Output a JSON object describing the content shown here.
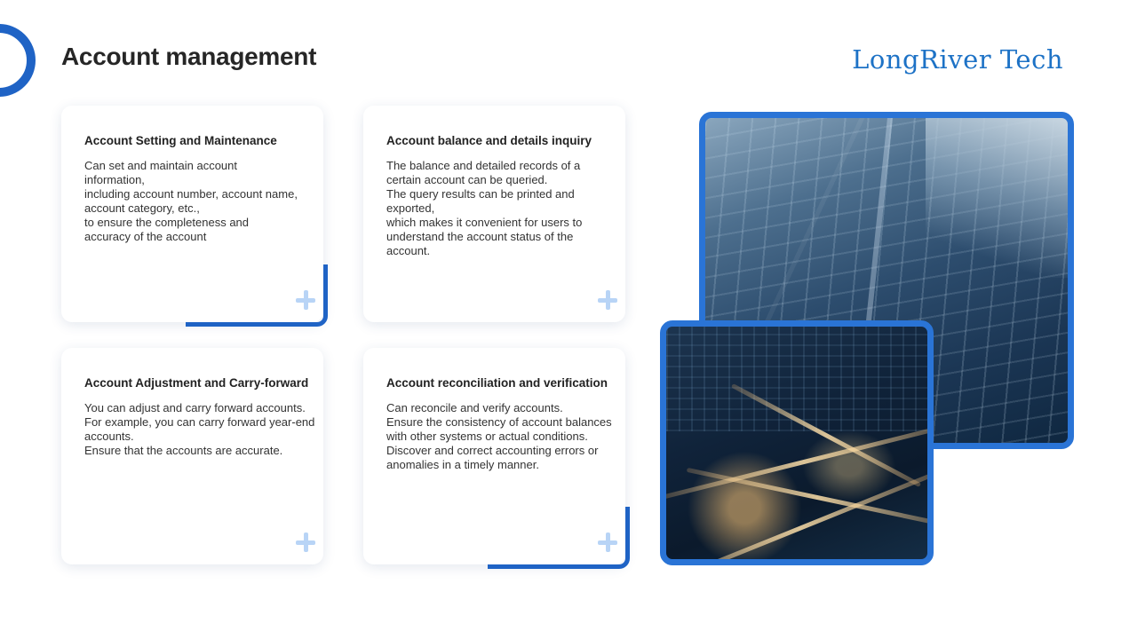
{
  "header": {
    "title": "Account management",
    "brand": "LongRiver Tech"
  },
  "cards": [
    {
      "title": "Account Setting and Maintenance",
      "text": "Can set and maintain account information,\nincluding account number, account name, account category, etc.,\nto ensure the completeness and accuracy of the account",
      "icon": "plus-icon"
    },
    {
      "title": "Account balance and details inquiry",
      "text": "The balance and detailed records of a certain account can be queried.\nThe query results can be printed and exported,\nwhich makes it convenient for users to understand the account status of the account.",
      "icon": "plus-icon"
    },
    {
      "title": "Account Adjustment and Carry-forward",
      "text": "You can adjust and carry forward accounts.\nFor example, you can carry forward year-end accounts.\nEnsure that the accounts are accurate.",
      "icon": "plus-icon"
    },
    {
      "title": "Account reconciliation and verification",
      "text": "Can reconcile and verify accounts.\nEnsure the consistency of account balances with other systems or actual conditions.\nDiscover and correct accounting errors or anomalies in a timely manner.",
      "icon": "plus-icon"
    }
  ],
  "images": {
    "building": "glass-skyscraper-photo",
    "night": "night-highway-interchange-photo"
  },
  "colors": {
    "accent": "#1f63c5",
    "brand": "#1d72c6",
    "plus": "#b8d4f6"
  }
}
